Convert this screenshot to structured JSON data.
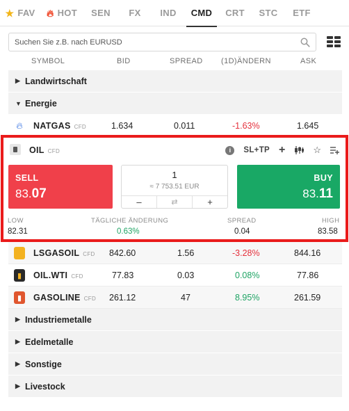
{
  "tabs": [
    {
      "label": "FAV",
      "icon": "star-icon"
    },
    {
      "label": "HOT",
      "icon": "fire-icon"
    },
    {
      "label": "SEN"
    },
    {
      "label": "FX"
    },
    {
      "label": "IND"
    },
    {
      "label": "CMD",
      "active": true
    },
    {
      "label": "CRT"
    },
    {
      "label": "STC"
    },
    {
      "label": "ETF"
    }
  ],
  "search": {
    "placeholder": "Suchen Sie z.B. nach EURUSD"
  },
  "columns": {
    "symbol": "SYMBOL",
    "bid": "BID",
    "spread": "SPREAD",
    "change": "(1D)ÄNDERN",
    "ask": "ASK"
  },
  "categories": {
    "agriculture": "Landwirtschaft",
    "energy": "Energie",
    "industrial_metals": "Industriemetalle",
    "precious_metals": "Edelmetalle",
    "other": "Sonstige",
    "livestock": "Livestock"
  },
  "cfd_tag": "CFD",
  "instruments": {
    "natgas": {
      "symbol": "NATGAS",
      "bid": "1.634",
      "spread": "0.011",
      "change": "-1.63%",
      "ask": "1.645"
    },
    "lsgasoil": {
      "symbol": "LSGASOIL",
      "bid": "842.60",
      "spread": "1.56",
      "change": "-3.28%",
      "ask": "844.16"
    },
    "oilwti": {
      "symbol": "OIL.WTI",
      "bid": "77.83",
      "spread": "0.03",
      "change": "0.08%",
      "ask": "77.86"
    },
    "gasoline": {
      "symbol": "GASOLINE",
      "bid": "261.12",
      "spread": "47",
      "change": "8.95%",
      "ask": "261.59"
    }
  },
  "oil_panel": {
    "symbol": "OIL",
    "sltp_label": "SL+TP",
    "sell": {
      "label": "SELL",
      "price_main": "83.",
      "price_big": "07"
    },
    "buy": {
      "label": "BUY",
      "price_main": "83.",
      "price_big": "11"
    },
    "quantity": "1",
    "quantity_value": "≈ 7 753.51 EUR",
    "minus": "–",
    "plus": "+",
    "stats": {
      "low_label": "LOW",
      "low": "82.31",
      "change_label": "TÄGLICHE ÄNDERUNG",
      "change": "0.63%",
      "spread_label": "SPREAD",
      "spread": "0.04",
      "high_label": "HIGH",
      "high": "83.58"
    }
  },
  "colors": {
    "sell": "#f0404a",
    "buy": "#19a865",
    "highlight_border": "#ea1b1b",
    "negative": "#e5303c",
    "positive": "#1fa464"
  }
}
